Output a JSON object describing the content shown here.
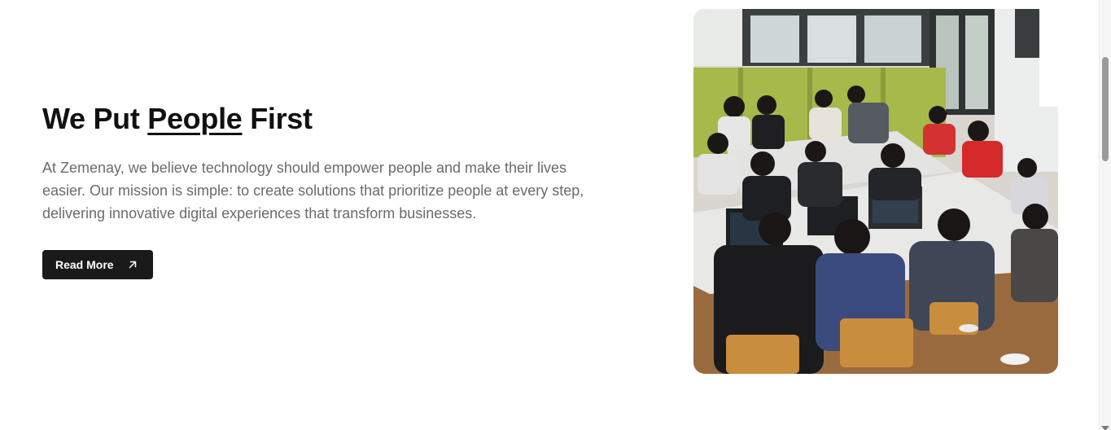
{
  "section": {
    "heading_before": "We Put",
    "heading_highlight": "People",
    "heading_after": "First",
    "description": "At Zemenay, we believe technology should empower people and make their lives easier. Our mission is simple: to create solutions that prioritize people at every step, delivering innovative digital experiences that transform businesses.",
    "button_label": "Read More",
    "button_icon": "arrow-up-right-icon"
  },
  "photo": {
    "subject": "team-collaboration-photo"
  },
  "colors": {
    "heading": "#111111",
    "body_text": "#6b6b6b",
    "button_bg": "#1a1a1a",
    "button_text": "#ffffff"
  }
}
